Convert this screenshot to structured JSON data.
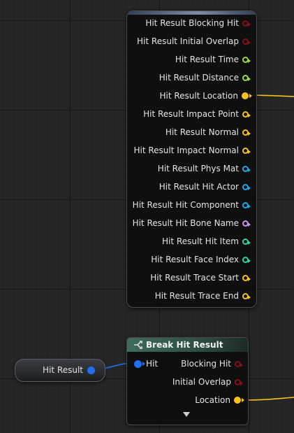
{
  "top_node": {
    "pins": [
      {
        "label": "Hit Result Blocking Hit",
        "color": "#8b0f1a",
        "filled": false
      },
      {
        "label": "Hit Result Initial Overlap",
        "color": "#8b0f1a",
        "filled": false
      },
      {
        "label": "Hit Result Time",
        "color": "#9ddc3a",
        "filled": false
      },
      {
        "label": "Hit Result Distance",
        "color": "#9ddc3a",
        "filled": false
      },
      {
        "label": "Hit Result Location",
        "color": "#f8c21c",
        "filled": true
      },
      {
        "label": "Hit Result Impact Point",
        "color": "#f8c21c",
        "filled": false
      },
      {
        "label": "Hit Result Normal",
        "color": "#f8c21c",
        "filled": false
      },
      {
        "label": "Hit Result Impact Normal",
        "color": "#f8c21c",
        "filled": false
      },
      {
        "label": "Hit Result Phys Mat",
        "color": "#1ea6e6",
        "filled": false
      },
      {
        "label": "Hit Result Hit Actor",
        "color": "#1ea6e6",
        "filled": false
      },
      {
        "label": "Hit Result Hit Component",
        "color": "#1ea6e6",
        "filled": false
      },
      {
        "label": "Hit Result Hit Bone Name",
        "color": "#c793ef",
        "filled": false
      },
      {
        "label": "Hit Result Hit Item",
        "color": "#2fd4a6",
        "filled": false
      },
      {
        "label": "Hit Result Face Index",
        "color": "#2fd4a6",
        "filled": false
      },
      {
        "label": "Hit Result Trace Start",
        "color": "#f8c21c",
        "filled": false
      },
      {
        "label": "Hit Result Trace End",
        "color": "#f8c21c",
        "filled": false
      }
    ]
  },
  "variable_node": {
    "label": "Hit Result",
    "pin_color": "#1d70f2"
  },
  "break_node": {
    "title": "Break Hit Result",
    "input": {
      "label": "Hit",
      "color": "#1d70f2"
    },
    "outputs": [
      {
        "label": "Blocking Hit",
        "color": "#8b0f1a",
        "filled": false
      },
      {
        "label": "Initial Overlap",
        "color": "#8b0f1a",
        "filled": false
      },
      {
        "label": "Location",
        "color": "#f8c21c",
        "filled": true
      }
    ]
  },
  "wire_colors": {
    "exec": "#1d70f2",
    "vector": "#f8c21c"
  }
}
